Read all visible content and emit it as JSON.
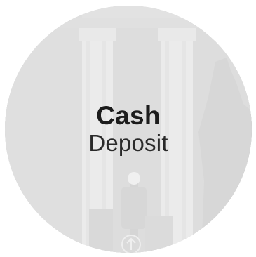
{
  "tile": {
    "title_line1": "Cash",
    "title_line2": "Deposit",
    "background_image": "building-columns-with-statue-photo",
    "text_color": "#1c1c1c",
    "overlay_color": "#ececec",
    "icon": "up-arrow-traffic-light-icon"
  }
}
